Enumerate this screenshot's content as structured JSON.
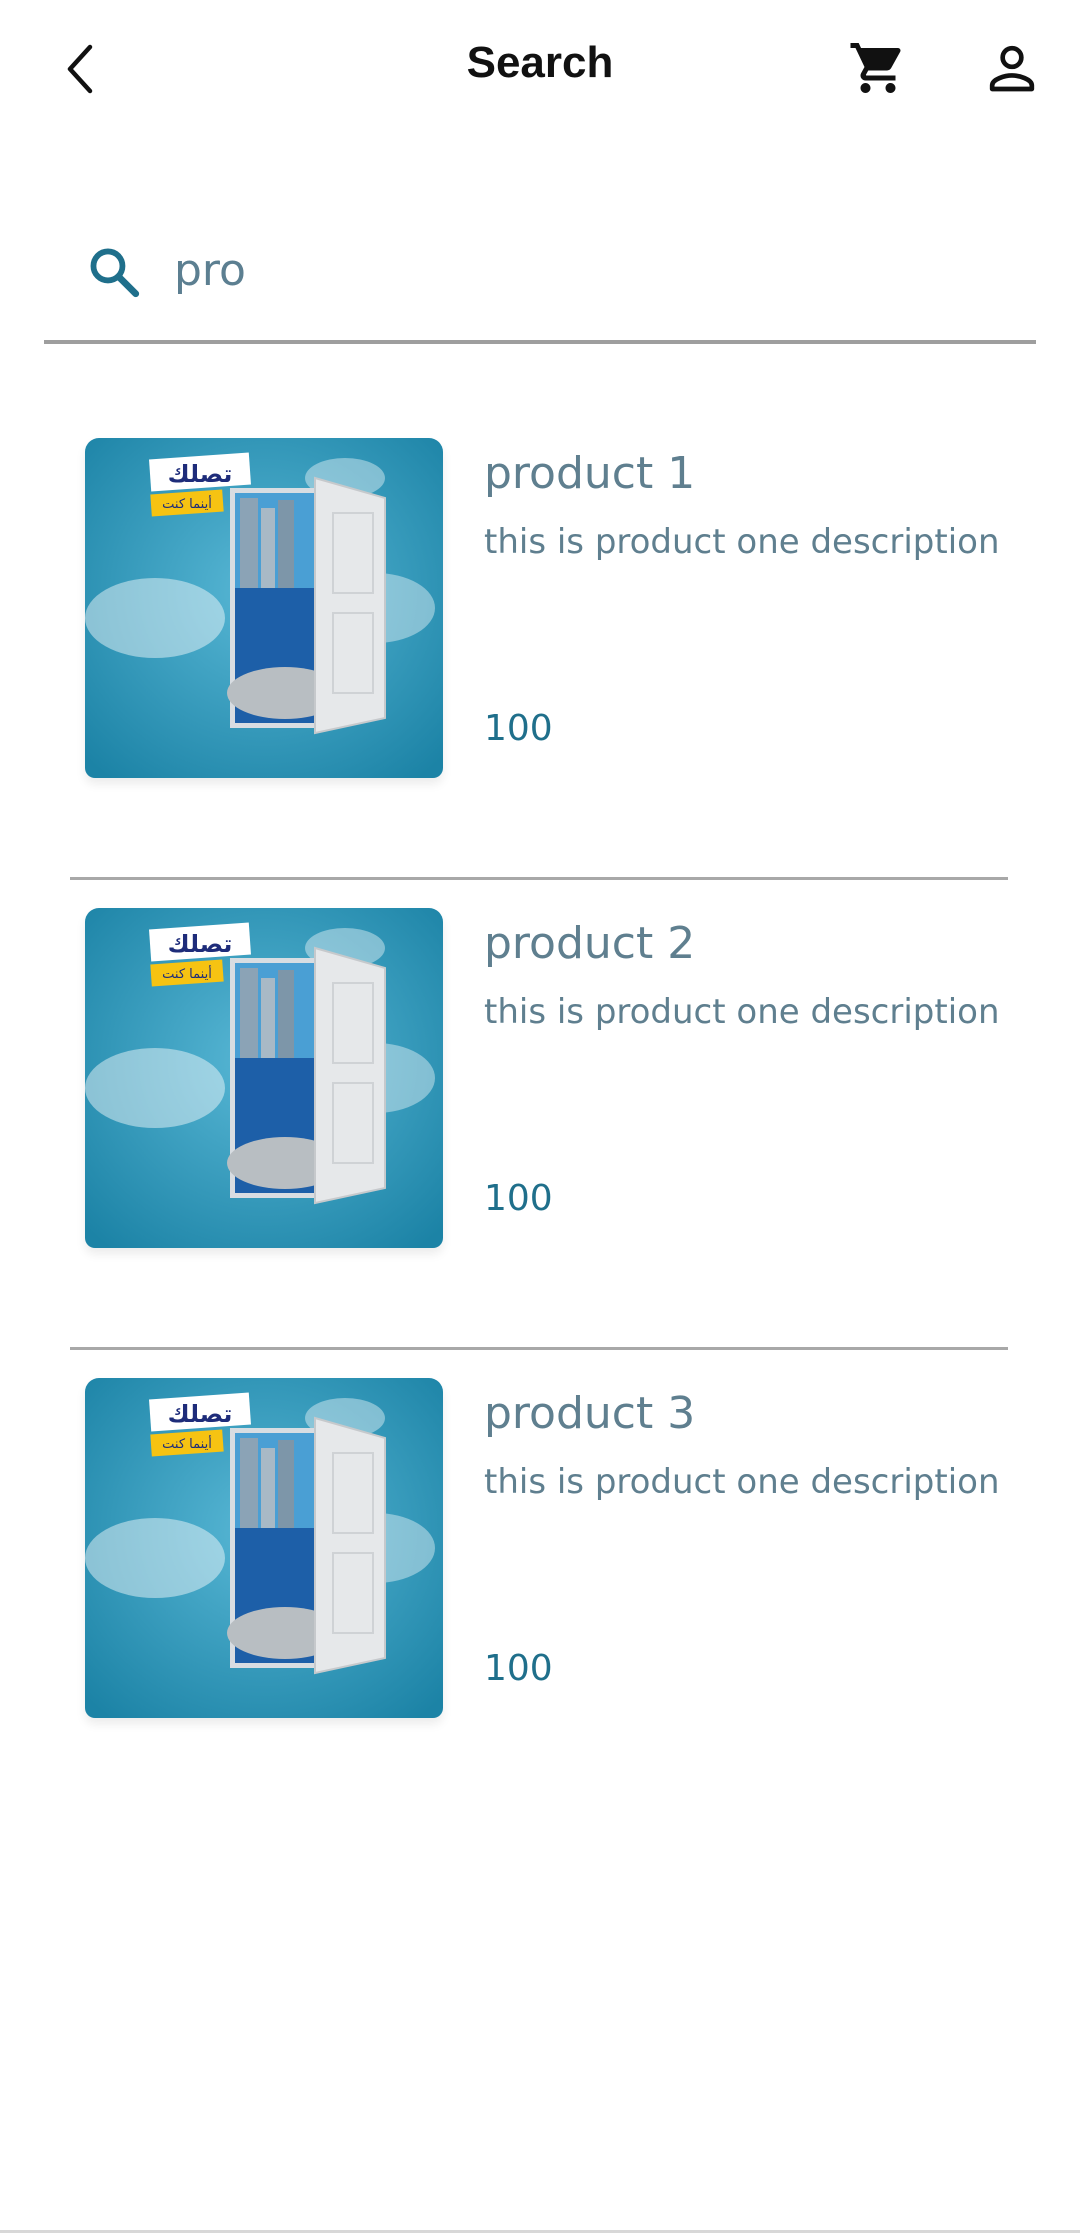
{
  "header": {
    "title": "Search",
    "back_icon": "chevron-left-icon",
    "cart_icon": "shopping-cart-icon",
    "profile_icon": "person-icon"
  },
  "search": {
    "value": "pro",
    "icon": "search-icon"
  },
  "products": [
    {
      "name": "product 1",
      "description": "this is product one description",
      "price": "100",
      "image_text": "تصلك",
      "image_subtext": "أينما كنت"
    },
    {
      "name": "product 2",
      "description": "this is product one description",
      "price": "100",
      "image_text": "تصلك",
      "image_subtext": "أينما كنت"
    },
    {
      "name": "product 3",
      "description": "this is product one description",
      "price": "100",
      "image_text": "تصلك",
      "image_subtext": "أينما كنت"
    }
  ],
  "colors": {
    "accent": "#1f6f8b",
    "text_muted": "#5f7f8f",
    "divider": "#a8a8a8"
  }
}
